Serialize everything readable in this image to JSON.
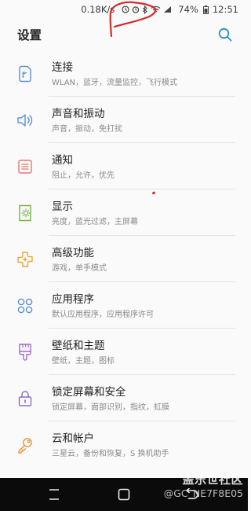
{
  "status_bar": {
    "net_speed": "0.18K/s",
    "battery": "74%",
    "time": "12:51"
  },
  "header": {
    "title": "设置"
  },
  "menu": [
    {
      "title": "连接",
      "subtitle": "WLAN，蓝牙，流量监控，飞行模式",
      "icon": "connection-icon",
      "color": "#5a8fd8"
    },
    {
      "title": "声音和振动",
      "subtitle": "声音，振动，免打扰",
      "icon": "sound-icon",
      "color": "#5a8fd8"
    },
    {
      "title": "通知",
      "subtitle": "阻止，允许，优先",
      "icon": "notification-icon",
      "color": "#e0796a"
    },
    {
      "title": "显示",
      "subtitle": "亮度，蓝光过滤，主屏幕",
      "icon": "display-icon",
      "color": "#7ab34a"
    },
    {
      "title": "高级功能",
      "subtitle": "游戏，单手模式",
      "icon": "advanced-features-icon",
      "color": "#e5a93a"
    },
    {
      "title": "应用程序",
      "subtitle": "默认应用程序，应用程序许可",
      "icon": "apps-icon",
      "color": "#5a8fd8"
    },
    {
      "title": "壁纸和主题",
      "subtitle": "壁纸，主题，图标",
      "icon": "theme-icon",
      "color": "#a06bc9"
    },
    {
      "title": "锁定屏幕和安全",
      "subtitle": "锁定屏幕，面部识别，指纹，虹膜",
      "icon": "lock-icon",
      "color": "#8a6bc9"
    },
    {
      "title": "云和帐户",
      "subtitle": "三星云，备份和恢复，S 换机助手",
      "icon": "key-icon",
      "color": "#e5973a"
    }
  ],
  "watermark": {
    "line1": "盖乐世社区",
    "line2": "@GC_NE7F8E05"
  }
}
